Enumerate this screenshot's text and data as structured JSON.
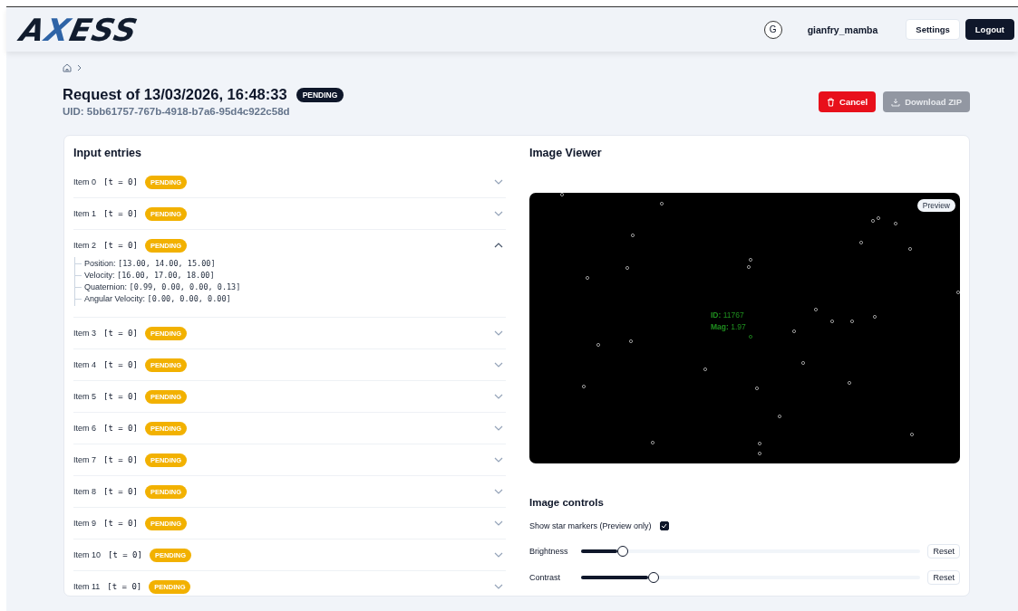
{
  "header": {
    "logo": "AXESS",
    "avatar": "G",
    "username": "gianfry_mamba",
    "buttons": [
      {
        "label": "Settings",
        "kind": "light"
      },
      {
        "label": "Logout",
        "kind": "dark"
      }
    ]
  },
  "request": {
    "title": "Request of 13/03/2026, 16:48:33",
    "status": "PENDING",
    "uid": "UID: 5bb61757-767b-4918-b7a6-95d4c922c58d",
    "actions": [
      {
        "label": "Cancel",
        "kind": "danger",
        "disabled": false
      },
      {
        "label": "Download ZIP",
        "kind": "download",
        "disabled": true
      }
    ]
  },
  "entries": {
    "title": "Input entries",
    "items": [
      {
        "label": "Item 0",
        "time": "[t = 0]",
        "status": "PENDING",
        "expanded": false
      },
      {
        "label": "Item 1",
        "time": "[t = 0]",
        "status": "PENDING",
        "expanded": false
      },
      {
        "label": "Item 2",
        "time": "[t = 0]",
        "status": "PENDING",
        "expanded": true,
        "details": [
          {
            "label": "Position:",
            "value": "[13.00, 14.00, 15.00]"
          },
          {
            "label": "Velocity:",
            "value": "[16.00, 17.00, 18.00]"
          },
          {
            "label": "Quaternion:",
            "value": "[0.99, 0.00, 0.00, 0.13]"
          },
          {
            "label": "Angular Velocity:",
            "value": "[0.00, 0.00, 0.00]"
          }
        ]
      },
      {
        "label": "Item 3",
        "time": "[t = 0]",
        "status": "PENDING",
        "expanded": false
      },
      {
        "label": "Item 4",
        "time": "[t = 0]",
        "status": "PENDING",
        "expanded": false
      },
      {
        "label": "Item 5",
        "time": "[t = 0]",
        "status": "PENDING",
        "expanded": false
      },
      {
        "label": "Item 6",
        "time": "[t = 0]",
        "status": "PENDING",
        "expanded": false
      },
      {
        "label": "Item 7",
        "time": "[t = 0]",
        "status": "PENDING",
        "expanded": false
      },
      {
        "label": "Item 8",
        "time": "[t = 0]",
        "status": "PENDING",
        "expanded": false
      },
      {
        "label": "Item 9",
        "time": "[t = 0]",
        "status": "PENDING",
        "expanded": false
      },
      {
        "label": "Item 10",
        "time": "[t = 0]",
        "status": "PENDING",
        "expanded": false
      },
      {
        "label": "Item 11",
        "time": "[t = 0]",
        "status": "PENDING",
        "expanded": false
      }
    ]
  },
  "viewer": {
    "title": "Image Viewer",
    "badge": "Preview",
    "star_id": "**ID:** 11767",
    "star_mag": "**Mag:** 1.97"
  },
  "controls": {
    "title": "Image controls",
    "markers": {
      "label": "Show star markers (Preview only)",
      "checked": true
    },
    "sliders": [
      {
        "label": "Brightness",
        "level": 0.12,
        "button": "Reset"
      },
      {
        "label": "Contrast",
        "level": 0.21,
        "button": "Reset"
      }
    ]
  }
}
